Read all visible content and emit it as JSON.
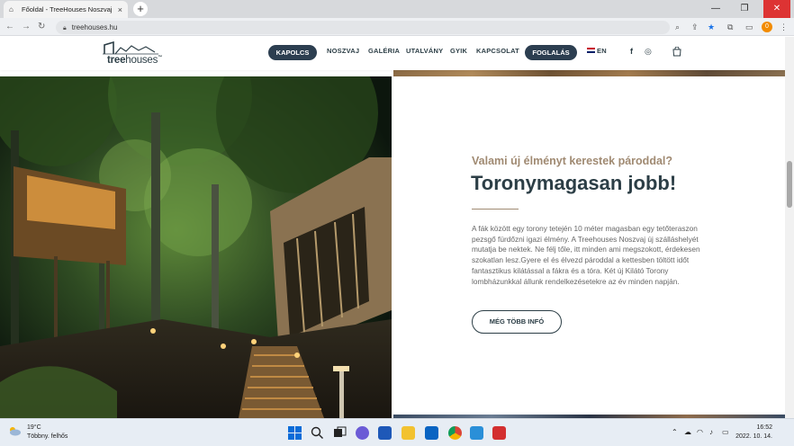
{
  "browser": {
    "tab_title": "Főoldal - TreeHouses Noszvaj",
    "tab_close": "×",
    "new_tab": "+",
    "url": "treehouses.hu",
    "extension_badge": "0",
    "win_min": "—",
    "win_restore": "❐",
    "win_close": "✕",
    "back": "←",
    "forward": "→",
    "reload": "↻"
  },
  "header": {
    "logo_bold": "tree",
    "logo_light": "houses",
    "logo_tm": "™",
    "nav": [
      "KAPOLCS",
      "NOSZVAJ",
      "GALÉRIA",
      "UTALVÁNY",
      "GYIK",
      "KAPCSOLAT",
      "FOGLALÁS"
    ],
    "lang": "EN",
    "facebook": "f",
    "instagram": "◎",
    "cart": "⌂"
  },
  "hero": {
    "kicker": "Valami új élményt kerestek pároddal?",
    "title": "Toronymagasan jobb!",
    "body": "A fák között egy torony tetején 10 méter magasban egy tetőteraszon pezsgő fürdőzni igazi élmény. A Treehouses Noszvaj új szálláshelyét mutatja be nektek. Ne félj tőle, itt minden ami megszokott, érdekesen szokatlan lesz.Gyere el és élvezd pároddal a kettesben töltött időt fantasztikus kilátással a fákra és a tóra. Két új Kilátó Torony lombházunkkal állunk rendelkezésetekre az év minden napján.",
    "button": "MÉG TÖBB INFÓ"
  },
  "taskbar": {
    "temp": "19°C",
    "weather": "Többny. felhős",
    "time": "16:52",
    "date": "2022. 10. 14."
  },
  "colors": {
    "navy": "#2c3e50",
    "accent": "#a08a72",
    "text": "#2c3e46"
  }
}
